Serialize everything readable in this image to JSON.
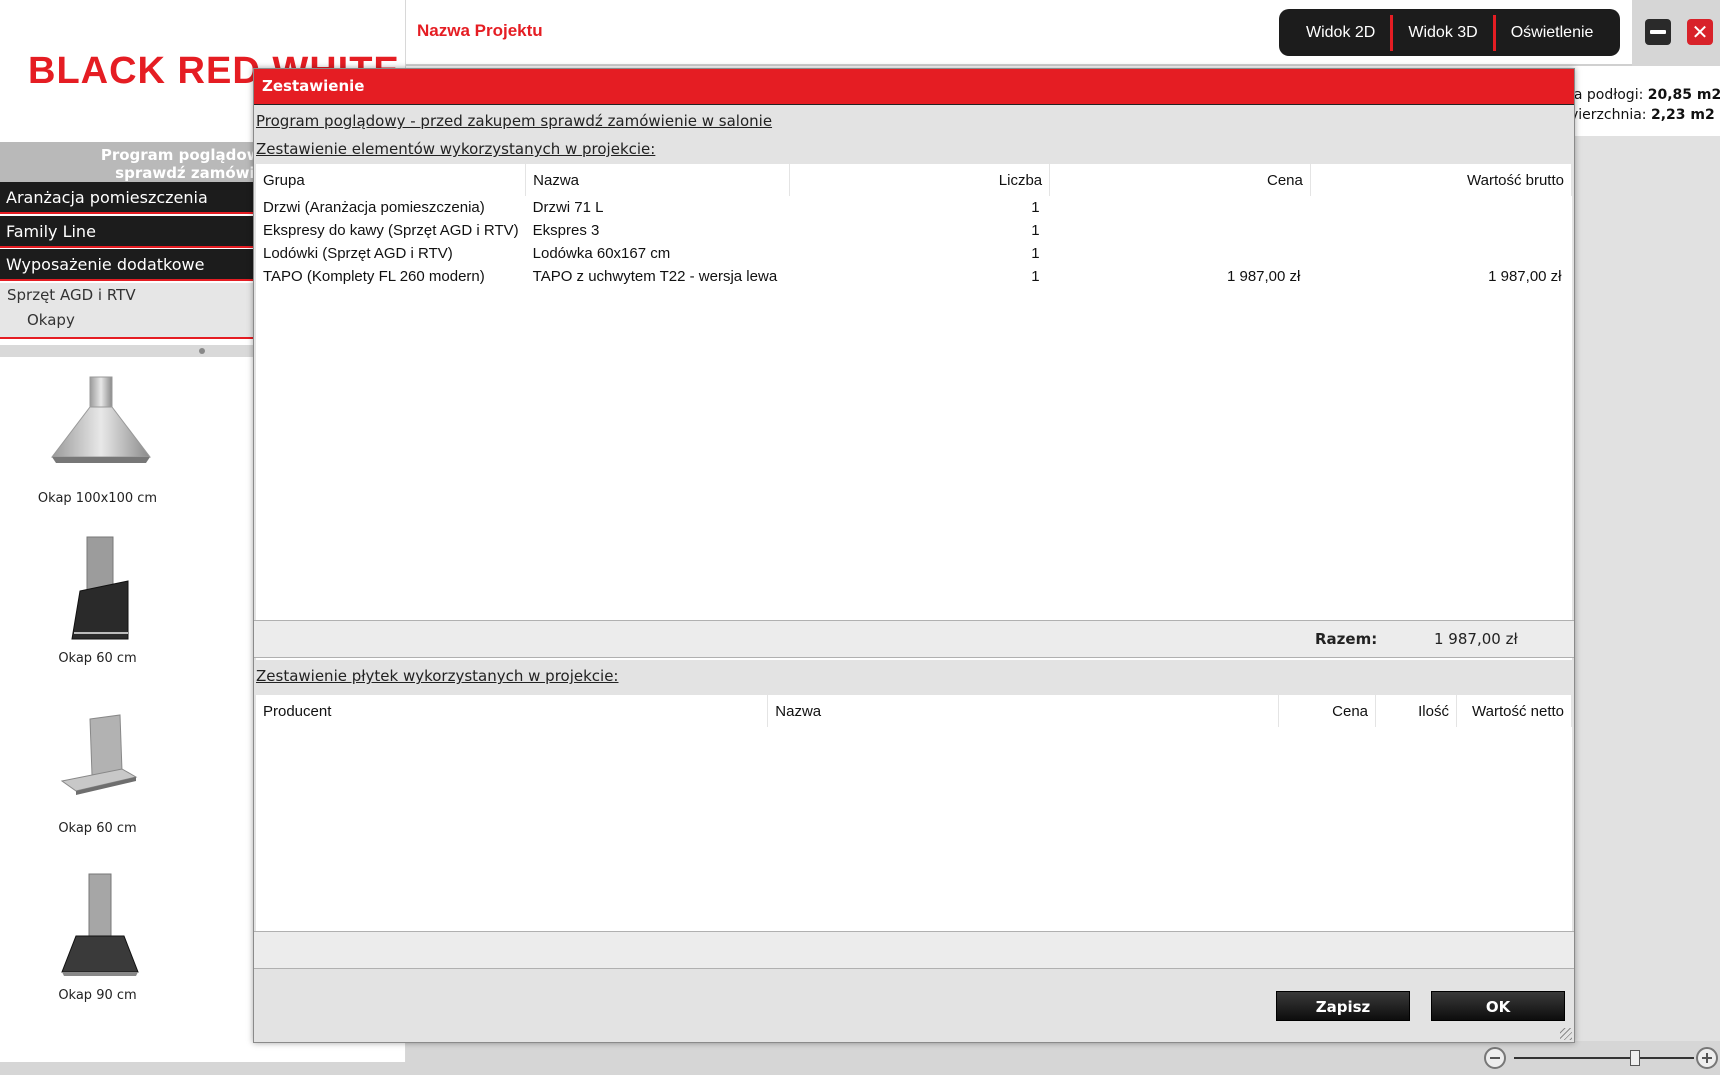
{
  "brand": {
    "logo_text": "BLACK RED WHITE"
  },
  "topbar": {
    "project_name": "Nazwa Projektu",
    "views": [
      "Widok 2D",
      "Widok 3D",
      "Oświetlenie"
    ]
  },
  "sidebar": {
    "notice_line1": "Program poglądowy - pr",
    "notice_line2": "sprawdź zamówienie",
    "categories": [
      "Aranżacja pomieszczenia",
      "Family Line",
      "Wyposażenie dodatkowe"
    ],
    "subcategory": "Sprzęt AGD i RTV",
    "subitem": "Okapy",
    "products": [
      {
        "label": "Okap 100x100 cm",
        "icon": "chimney-hood-icon"
      },
      {
        "label": "Okap 60 cm",
        "icon": "glass-hood-icon"
      },
      {
        "label": "Okap 60 cm",
        "icon": "box-hood-icon"
      },
      {
        "label": "Okap 90 cm",
        "icon": "chimney-hood-icon"
      }
    ]
  },
  "right_info": {
    "floor_label": "ia podłogi:",
    "floor_value": "20,85 m2",
    "surface_label": "vierzchnia:",
    "surface_value": "2,23 m2"
  },
  "dialog": {
    "title": "Zestawienie",
    "notice_link": "Program poglądowy - przed zakupem sprawdź zamówienie w salonie",
    "elements_heading": "Zestawienie elementów wykorzystanych w projekcie:",
    "elements_columns": [
      "Grupa",
      "Nazwa",
      "Liczba",
      "Cena",
      "Wartość brutto"
    ],
    "elements_rows": [
      {
        "grupa": "Drzwi (Aranżacja pomieszczenia)",
        "nazwa": "Drzwi 71 L",
        "liczba": "1",
        "cena": "",
        "wartosc": ""
      },
      {
        "grupa": "Ekspresy do kawy (Sprzęt AGD i RTV)",
        "nazwa": "Ekspres 3",
        "liczba": "1",
        "cena": "",
        "wartosc": ""
      },
      {
        "grupa": "Lodówki (Sprzęt AGD i RTV)",
        "nazwa": "Lodówka 60x167 cm",
        "liczba": "1",
        "cena": "",
        "wartosc": ""
      },
      {
        "grupa": "TAPO (Komplety FL 260 modern)",
        "nazwa": "TAPO z uchwytem T22 - wersja lewa",
        "liczba": "1",
        "cena": "1 987,00 zł",
        "wartosc": "1 987,00 zł"
      }
    ],
    "total_label": "Razem:",
    "total_value": "1 987,00 zł",
    "tiles_heading": "Zestawienie płytek wykorzystanych w projekcie:",
    "tiles_columns": [
      "Producent",
      "Nazwa",
      "Cena",
      "Ilość",
      "Wartość netto"
    ],
    "tiles_rows": [],
    "save_label": "Zapisz",
    "ok_label": "OK"
  },
  "zoom": {
    "level": 0.68
  },
  "colors": {
    "brand_red": "#e51d23",
    "dark": "#1c1c1c",
    "dialog_bg": "#e3e3e3"
  }
}
